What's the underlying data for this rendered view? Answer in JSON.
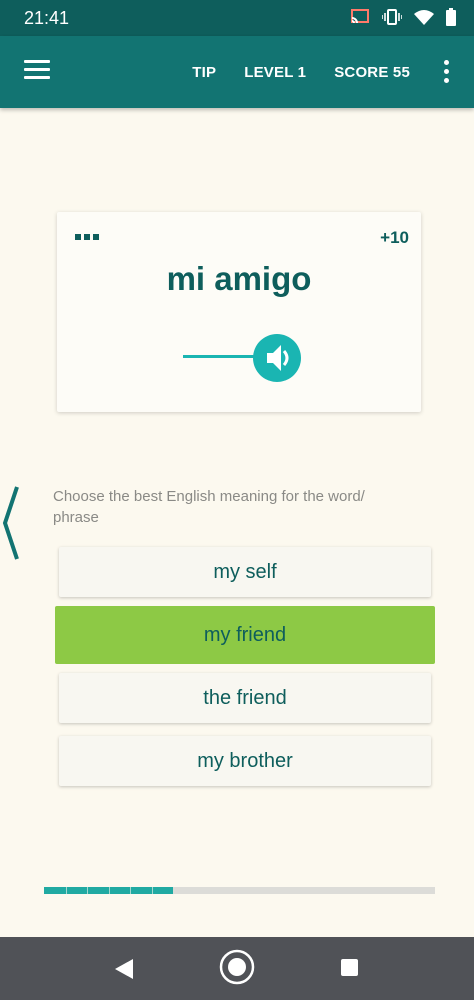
{
  "status_bar": {
    "time": "21:41"
  },
  "app_bar": {
    "tip_label": "TIP",
    "level_label": "LEVEL 1",
    "score_label": "SCORE 55"
  },
  "card": {
    "points": "+10",
    "word": "mi amigo"
  },
  "instruction": "Choose the best English meaning for the word/\nphrase",
  "options": [
    {
      "label": "my self",
      "selected": false
    },
    {
      "label": "my friend",
      "selected": true
    },
    {
      "label": "the friend",
      "selected": false
    },
    {
      "label": "my brother",
      "selected": false
    }
  ],
  "progress": {
    "fraction": 0.33,
    "segments": 6
  },
  "colors": {
    "primary": "#127472",
    "primary_dark": "#0e5e5c",
    "accent": "#1ab5b2",
    "selected": "#8dc945",
    "background": "#fcf9ef"
  }
}
